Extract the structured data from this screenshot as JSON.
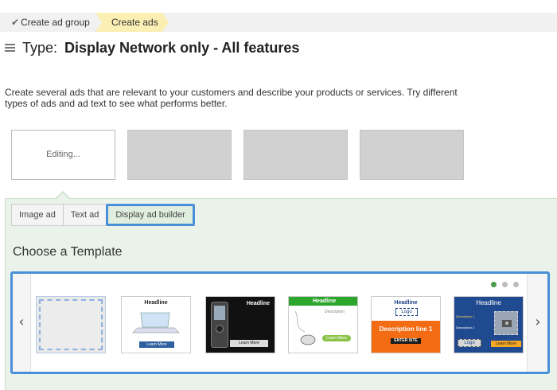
{
  "breadcrumb": {
    "step1": "Create ad group",
    "step2": "Create ads"
  },
  "title": {
    "label": "Type:",
    "value": "Display Network only - All features"
  },
  "description": "Create several ads that are relevant to your customers and describe your products or services. Try different types of ads and ad text to see what performs better.",
  "ads": {
    "editing_label": "Editing..."
  },
  "tabs": [
    {
      "label": "Image ad"
    },
    {
      "label": "Text ad"
    },
    {
      "label": "Display ad builder"
    }
  ],
  "section_title": "Choose a Template",
  "carousel": {
    "prev": "‹",
    "next": "›",
    "templates": [
      {
        "headline": ""
      },
      {
        "headline": "Headline",
        "button": "Learn More"
      },
      {
        "headline": "Headline",
        "button": "Learn More"
      },
      {
        "headline": "Headline",
        "sub": "Description",
        "button": "Learn More"
      },
      {
        "headline": "Headline",
        "logo": "Logo",
        "line": "Description line 1",
        "button": "ENTER SITE"
      },
      {
        "headline": "Headline",
        "d1": "Description 1",
        "d2": "Description 2",
        "logo": "Logo",
        "button": "Learn More"
      }
    ]
  },
  "colors": {
    "accent_blue": "#4a90d9",
    "panel_green": "#eaf3ea",
    "crumb_yellow": "#fcefb4",
    "dot_active": "#4c9a4c"
  }
}
